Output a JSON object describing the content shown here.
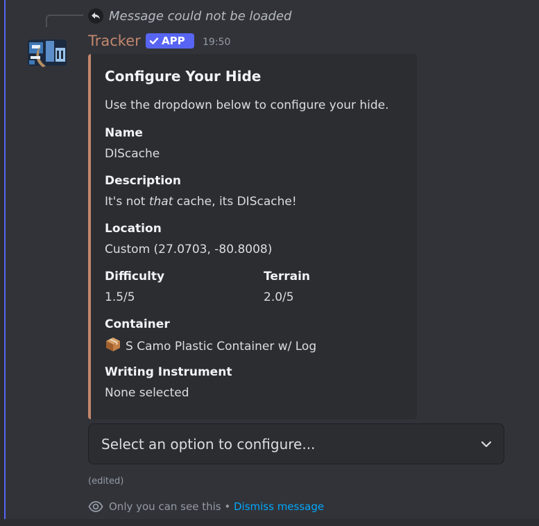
{
  "reply": {
    "text": "Message could not be loaded"
  },
  "message": {
    "author": "Tracker",
    "badge": "APP",
    "timestamp": "19:50",
    "edited_label": "(edited)"
  },
  "embed": {
    "accent_color": "#c2876d",
    "title": "Configure Your Hide",
    "description": "Use the dropdown below to configure your hide.",
    "fields": {
      "name": {
        "label": "Name",
        "value": "DIScache"
      },
      "description": {
        "label": "Description",
        "value_before": "It's not ",
        "value_emphasis": "that",
        "value_after": " cache, its DIScache!"
      },
      "location": {
        "label": "Location",
        "value": "Custom (27.0703, -80.8008)"
      },
      "difficulty": {
        "label": "Difficulty",
        "value": "1.5/5"
      },
      "terrain": {
        "label": "Terrain",
        "value": "2.0/5"
      },
      "container": {
        "label": "Container",
        "icon": "package-icon",
        "value": "S Camo Plastic Container w/ Log"
      },
      "writing_instrument": {
        "label": "Writing Instrument",
        "value": "None selected"
      }
    }
  },
  "select_menu": {
    "placeholder": "Select an option to configure...",
    "icon": "chevron-down-icon"
  },
  "ephemeral_notice": {
    "icon": "eye-icon",
    "text": "Only you can see this",
    "separator": " • ",
    "dismiss_label": "Dismiss message"
  },
  "colors": {
    "background": "#323339",
    "embed_background": "#2b2d31",
    "author": "#c2876d",
    "badge": "#5865f2",
    "link": "#00a8fc",
    "left_bar": "#5865f2"
  }
}
